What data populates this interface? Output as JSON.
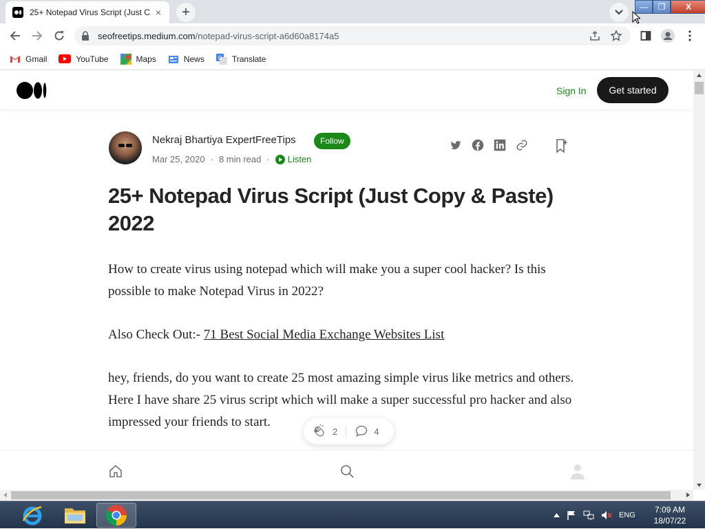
{
  "browser": {
    "tab_title": "25+ Notepad Virus Script (Just C",
    "tab_close": "×",
    "new_tab": "+",
    "url_host": "seofreetips.medium.com",
    "url_path": "/notepad-virus-script-a6d60a8174a5"
  },
  "window_controls": {
    "minimize": "—",
    "maximize": "❐",
    "close": "X"
  },
  "bookmarks": [
    {
      "label": "Gmail",
      "icon": "gmail-icon"
    },
    {
      "label": "YouTube",
      "icon": "youtube-icon"
    },
    {
      "label": "Maps",
      "icon": "maps-icon"
    },
    {
      "label": "News",
      "icon": "news-icon"
    },
    {
      "label": "Translate",
      "icon": "translate-icon"
    }
  ],
  "medium": {
    "sign_in": "Sign In",
    "get_started": "Get started"
  },
  "article": {
    "author": "Nekraj Bhartiya ExpertFreeTips",
    "follow": "Follow",
    "date": "Mar 25, 2020",
    "dot": "·",
    "read_time": "8 min read",
    "listen": "Listen",
    "title": "25+ Notepad Virus Script (Just Copy & Paste) 2022",
    "p1": "How to create virus using notepad which will make you a super cool hacker? Is this possible to make Notepad Virus in 2022?",
    "p2_prefix": "Also Check Out:- ",
    "p2_link": "71 Best Social Media Exchange Websites List",
    "p3": "hey, friends, do you want to create 25 most amazing simple virus like metrics and others. Here I have share 25 virus script which will make a super successful pro hacker and also impressed your friends to start.",
    "claps": "2",
    "responses": "4"
  },
  "taskbar": {
    "language": "ENG",
    "time": "7:09 AM",
    "date": "18/07/22"
  },
  "colors": {
    "medium_green": "#1a8917",
    "button_dark": "#191919",
    "text": "#242424"
  }
}
